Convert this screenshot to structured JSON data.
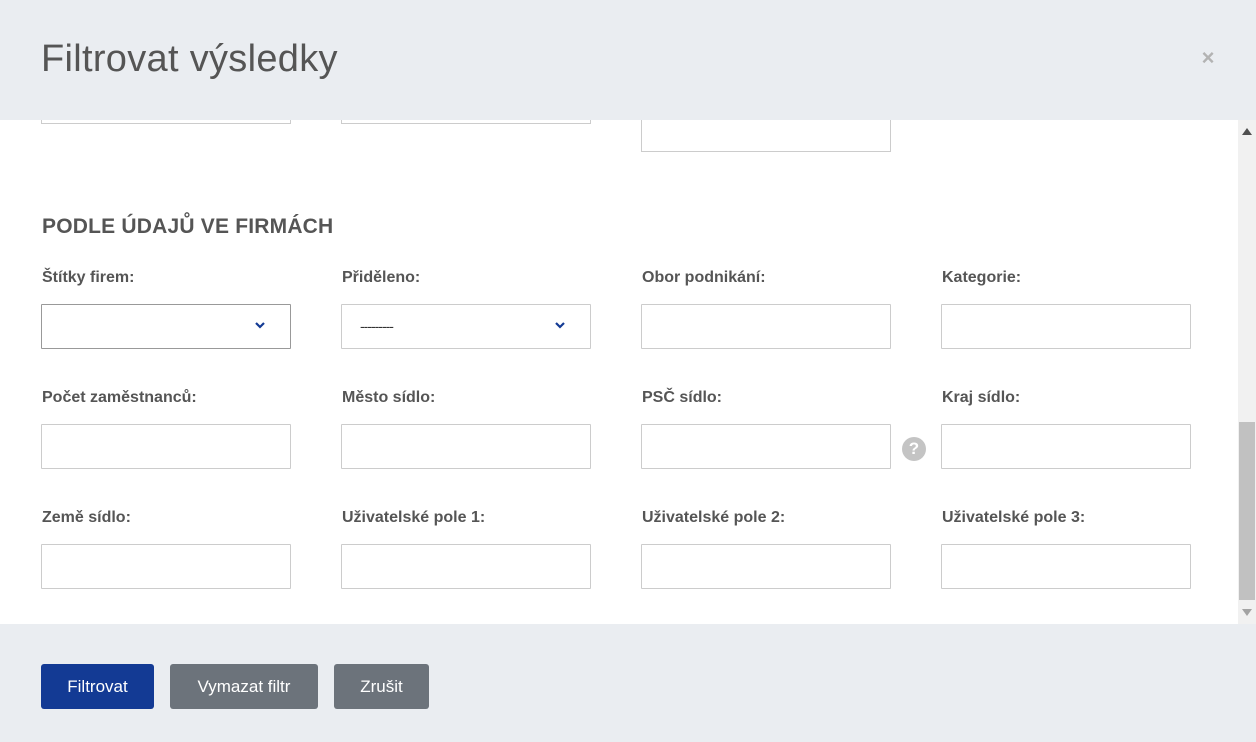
{
  "modal": {
    "title": "Filtrovat výsledky",
    "close_symbol": "×"
  },
  "section": {
    "title": "PODLE ÚDAJŮ VE FIRMÁCH"
  },
  "fields": {
    "stitky_firem": {
      "label": "Štítky firem:",
      "value": ""
    },
    "prideleno": {
      "label": "Přiděleno:",
      "value": "---------"
    },
    "obor_podnikani": {
      "label": "Obor podnikání:",
      "value": ""
    },
    "kategorie": {
      "label": "Kategorie:",
      "value": ""
    },
    "pocet_zamestnancu": {
      "label": "Počet zaměstnanců:",
      "value": ""
    },
    "mesto_sidlo": {
      "label": "Město sídlo:",
      "value": ""
    },
    "psc_sidlo": {
      "label": "PSČ sídlo:",
      "value": ""
    },
    "kraj_sidlo": {
      "label": "Kraj sídlo:",
      "value": ""
    },
    "zeme_sidlo": {
      "label": "Země sídlo:",
      "value": ""
    },
    "uzivatelske_pole_1": {
      "label": "Uživatelské pole 1:",
      "value": ""
    },
    "uzivatelske_pole_2": {
      "label": "Uživatelské pole 2:",
      "value": ""
    },
    "uzivatelske_pole_3": {
      "label": "Uživatelské pole 3:",
      "value": ""
    }
  },
  "help_symbol": "?",
  "footer": {
    "filter_label": "Filtrovat",
    "clear_label": "Vymazat filtr",
    "cancel_label": "Zrušit"
  },
  "colors": {
    "primary": "#133a94",
    "secondary": "#6c737b",
    "header_bg": "#eaedf1",
    "chevron": "#133a94"
  },
  "icons": [
    "close-icon",
    "chevron-down-icon",
    "help-icon"
  ]
}
